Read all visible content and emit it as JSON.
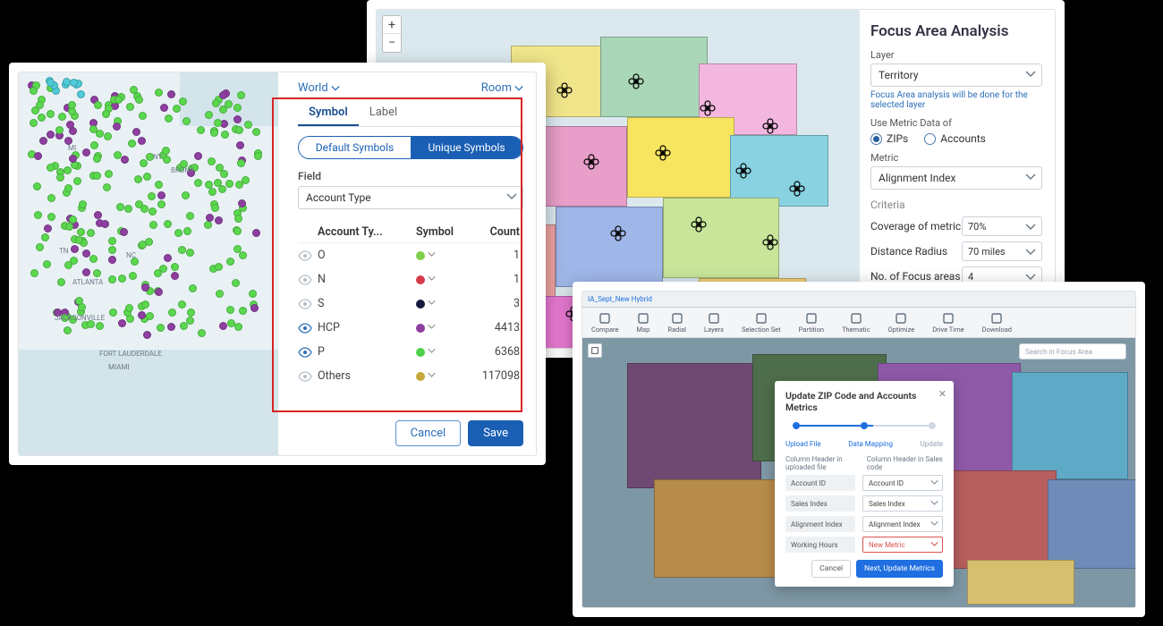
{
  "cardA": {
    "breadcrumb_left": "World",
    "breadcrumb_right": "Room",
    "tabs": {
      "symbol": "Symbol",
      "label": "Label"
    },
    "segments": {
      "default": "Default Symbols",
      "unique": "Unique Symbols"
    },
    "field_label": "Field",
    "field_value": "Account Type",
    "table": {
      "headers": {
        "type": "Account Ty...",
        "symbol": "Symbol",
        "count": "Count"
      },
      "rows": [
        {
          "visible": false,
          "type": "O",
          "color": "#7fd04a",
          "count": "1"
        },
        {
          "visible": false,
          "type": "N",
          "color": "#d43a4a",
          "count": "1"
        },
        {
          "visible": false,
          "type": "S",
          "color": "#171a3f",
          "count": "3"
        },
        {
          "visible": true,
          "type": "HCP",
          "color": "#8e3fa0",
          "count": "4413"
        },
        {
          "visible": true,
          "type": "P",
          "color": "#4fd24a",
          "count": "6368"
        },
        {
          "visible": false,
          "type": "Others",
          "color": "#c6a93b",
          "count": "117098"
        }
      ]
    },
    "buttons": {
      "cancel": "Cancel",
      "save": "Save"
    },
    "map_labels": [
      "MI",
      "NY",
      "BRONX",
      "TN",
      "NC",
      "ATLANTA",
      "JACKSONVILLE",
      "FORT LAUDERDALE",
      "MIAMI"
    ]
  },
  "cardB": {
    "title": "Focus Area Analysis",
    "layer_label": "Layer",
    "layer_value": "Territory",
    "layer_hint": "Focus Area analysis will be done for the selected layer",
    "metric_of_label": "Use Metric Data of",
    "metric_of_options": {
      "zips": "ZIPs",
      "accounts": "Accounts"
    },
    "metric_label": "Metric",
    "metric_value": "Alignment Index",
    "criteria_label": "Criteria",
    "criteria": [
      {
        "label": "Coverage of metric",
        "value": "70%"
      },
      {
        "label": "Distance Radius",
        "value": "70 miles"
      },
      {
        "label": "No. of Focus areas",
        "value": "4"
      }
    ]
  },
  "cardC": {
    "titlebar": "IA_Sept_New Hybrid",
    "toolbar": [
      "Compare",
      "Map",
      "Radial",
      "Layers",
      "Selection Set",
      "Partition",
      "Thematic",
      "Optimize",
      "Drive Time",
      "Download"
    ],
    "search_placeholder": "Search in Focus Area",
    "modal": {
      "title": "Update ZIP Code and Accounts Metrics",
      "steps": {
        "upload": "Upload File",
        "mapping": "Data Mapping",
        "update": "Update"
      },
      "col_left": "Column Header in uploaded file",
      "col_right": "Column Header in Sales code",
      "rows": [
        {
          "src": "Account ID",
          "dst": "Account ID",
          "error": false
        },
        {
          "src": "Sales Index",
          "dst": "Sales Index",
          "error": false
        },
        {
          "src": "Alignment Index",
          "dst": "Alignment Index",
          "error": false
        },
        {
          "src": "Working Hours",
          "dst": "New Metric",
          "error": true
        }
      ],
      "buttons": {
        "cancel": "Cancel",
        "next": "Next, Update Metrics"
      }
    }
  }
}
